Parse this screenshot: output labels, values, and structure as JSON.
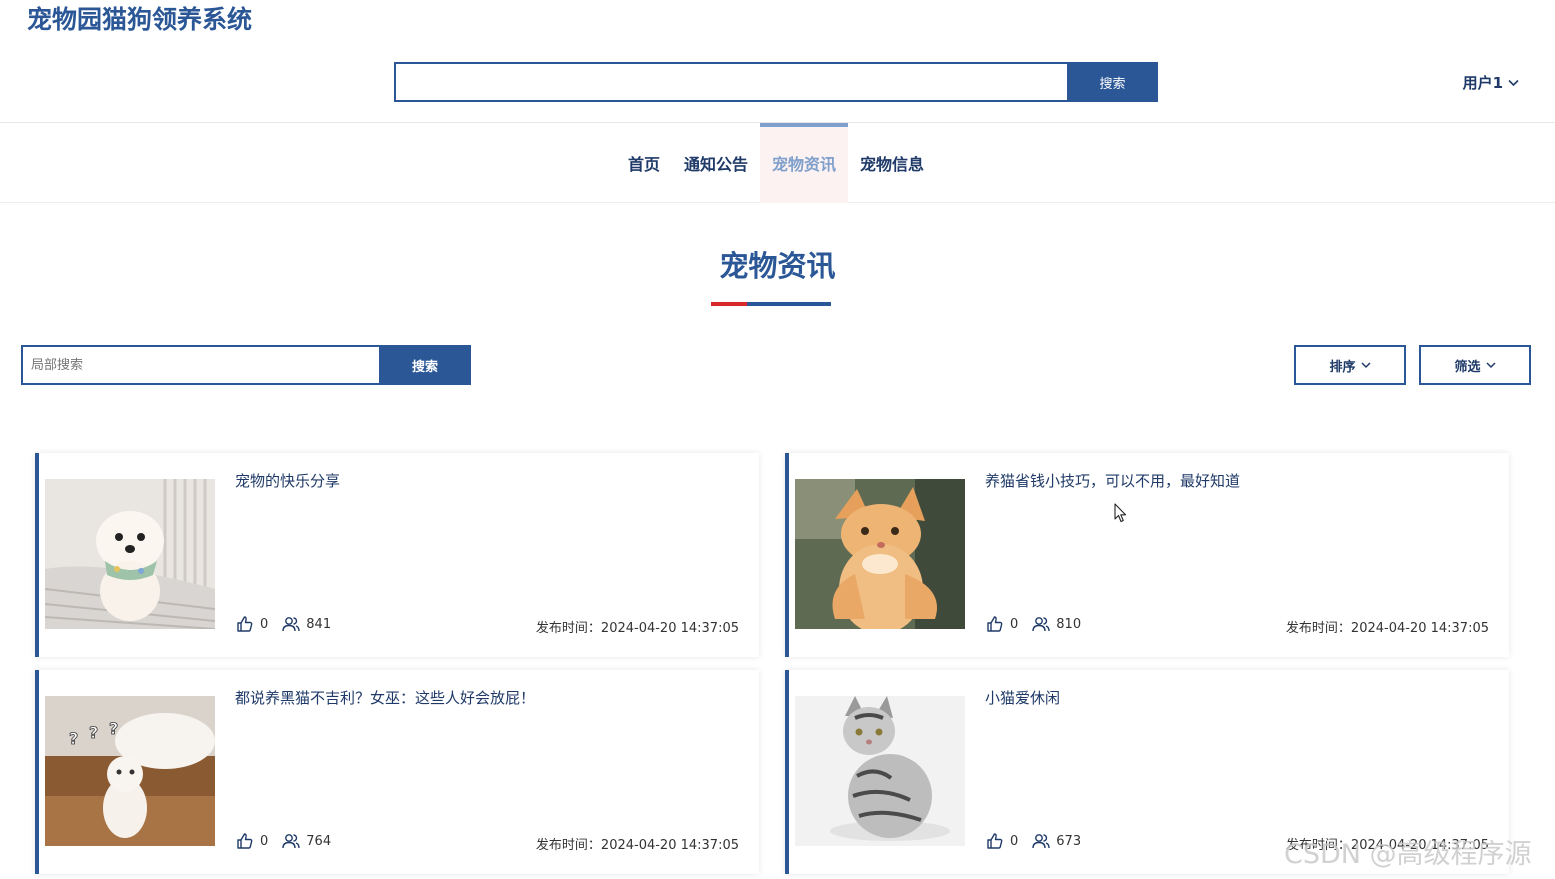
{
  "header": {
    "site_title": "宠物园猫狗领养系统",
    "search_button": "搜索",
    "user_label": "用户1"
  },
  "nav": {
    "items": [
      "首页",
      "通知公告",
      "宠物资讯",
      "宠物信息"
    ],
    "active": "宠物资讯"
  },
  "section": {
    "title": "宠物资讯"
  },
  "toolbar": {
    "search_placeholder": "局部搜索",
    "search_button": "搜索",
    "sort_label": "排序",
    "filter_label": "筛选"
  },
  "articles": [
    {
      "title": "宠物的快乐分享",
      "likes": "0",
      "views": "841",
      "time": "发布时间：2024-04-20 14:37:05"
    },
    {
      "title": "养猫省钱小技巧，可以不用，最好知道",
      "likes": "0",
      "views": "810",
      "time": "发布时间：2024-04-20 14:37:05"
    },
    {
      "title": "都说养黑猫不吉利？女巫：这些人好会放屁！",
      "likes": "0",
      "views": "764",
      "time": "发布时间：2024-04-20 14:37:05"
    },
    {
      "title": "小猫爱休闲",
      "likes": "0",
      "views": "673",
      "time": "发布时间：2024-04-20 14:37:05"
    }
  ],
  "watermark": "CSDN @高级程序源",
  "colors": {
    "primary": "#2b5797",
    "accent_red": "#d9272e",
    "nav_active": "#7fa0cc"
  }
}
